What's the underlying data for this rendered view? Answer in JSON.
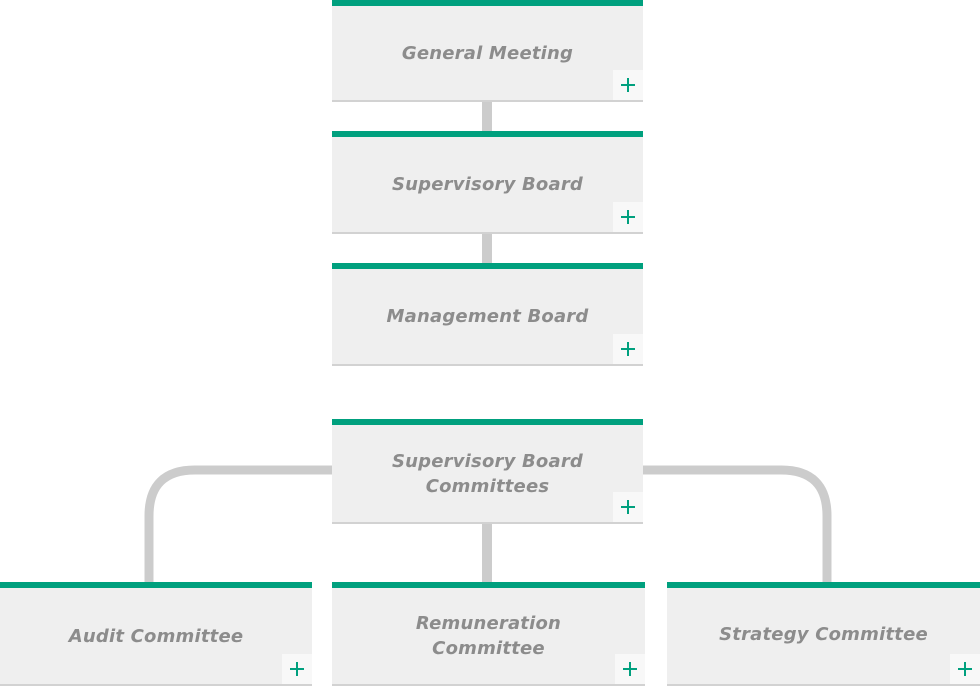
{
  "colors": {
    "accent": "#00a07e",
    "card_background": "#efefef",
    "connector": "#cccccc",
    "label_text": "#8c8c8c"
  },
  "nodes": [
    {
      "id": "general-meeting",
      "label": "General Meeting",
      "expand_icon": "plus-icon"
    },
    {
      "id": "supervisory-board",
      "label": "Supervisory Board",
      "expand_icon": "plus-icon"
    },
    {
      "id": "management-board",
      "label": "Management Board",
      "expand_icon": "plus-icon"
    },
    {
      "id": "supervisory-board-committees",
      "label": "Supervisory Board Committees",
      "expand_icon": "plus-icon"
    },
    {
      "id": "audit-committee",
      "label": "Audit Committee",
      "expand_icon": "plus-icon"
    },
    {
      "id": "remuneration-committee",
      "label": "Remuneration Committee",
      "expand_icon": "plus-icon"
    },
    {
      "id": "strategy-committee",
      "label": "Strategy Committee",
      "expand_icon": "plus-icon"
    }
  ],
  "edges": [
    {
      "from": "general-meeting",
      "to": "supervisory-board"
    },
    {
      "from": "supervisory-board",
      "to": "management-board"
    },
    {
      "from": "supervisory-board-committees",
      "to": "audit-committee"
    },
    {
      "from": "supervisory-board-committees",
      "to": "remuneration-committee"
    },
    {
      "from": "supervisory-board-committees",
      "to": "strategy-committee"
    }
  ]
}
